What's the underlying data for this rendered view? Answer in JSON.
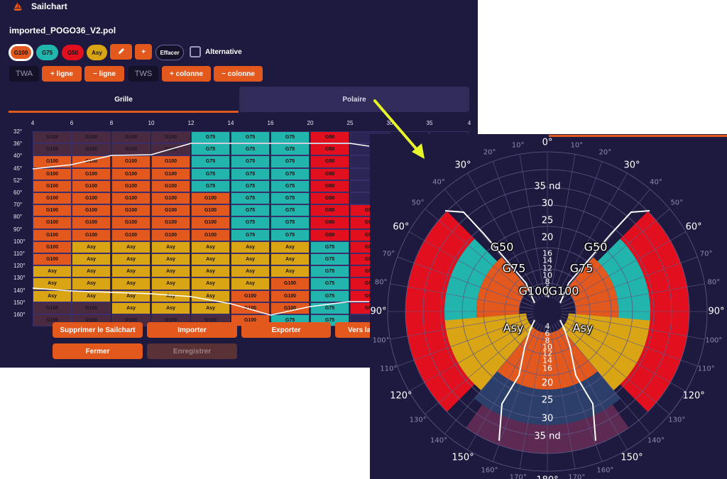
{
  "app": {
    "title": "Sailchart",
    "filename": "imported_POGO36_V2.pol"
  },
  "sails": [
    {
      "label": "G100",
      "color": "#e3581d",
      "selected": true
    },
    {
      "label": "G75",
      "color": "#21b5ad"
    },
    {
      "label": "G50",
      "color": "#e2101e"
    },
    {
      "label": "Asy",
      "color": "#d9a514"
    }
  ],
  "toolbar": {
    "edit_icon": "pencil-icon",
    "plus": "+",
    "effacer": "Effacer",
    "alternative": "Alternative",
    "twa_placeholder": "TWA",
    "add_row": "+ ligne",
    "remove_row": "− ligne",
    "tws_placeholder": "TWS",
    "add_col": "+ colonne",
    "remove_col": "− colonne"
  },
  "tabs": {
    "grille": "Grille",
    "polaire": "Polaire"
  },
  "grid": {
    "tws": [
      "4",
      "6",
      "8",
      "10",
      "12",
      "14",
      "16",
      "20",
      "25",
      "30",
      "35",
      "4"
    ],
    "twa": [
      "32°",
      "36°",
      "40°",
      "45°",
      "52°",
      "60°",
      "70°",
      "80°",
      "90°",
      "100°",
      "110°",
      "120°",
      "130°",
      "140°",
      "150°",
      "160°"
    ],
    "rows": [
      [
        "G100",
        "G100",
        "G100",
        "G100",
        "G75",
        "G75",
        "G75",
        "G50",
        "",
        "",
        ""
      ],
      [
        "G100",
        "G100",
        "G100",
        "G100",
        "G75",
        "G75",
        "G75",
        "G50",
        "",
        "",
        ""
      ],
      [
        "G100",
        "G100",
        "G100",
        "G100",
        "G75",
        "G75",
        "G75",
        "G50",
        "",
        "",
        ""
      ],
      [
        "G100",
        "G100",
        "G100",
        "G100",
        "G75",
        "G75",
        "G75",
        "G50",
        "",
        "",
        ""
      ],
      [
        "G100",
        "G100",
        "G100",
        "G100",
        "G75",
        "G75",
        "G75",
        "G50",
        "",
        "",
        ""
      ],
      [
        "G100",
        "G100",
        "G100",
        "G100",
        "G100",
        "G75",
        "G75",
        "G50",
        "",
        "",
        ""
      ],
      [
        "G100",
        "G100",
        "G100",
        "G100",
        "G100",
        "G75",
        "G75",
        "G50",
        "G50",
        "",
        ""
      ],
      [
        "G100",
        "G100",
        "G100",
        "G100",
        "G100",
        "G75",
        "G75",
        "G50",
        "G50",
        "",
        ""
      ],
      [
        "G100",
        "G100",
        "G100",
        "G100",
        "G100",
        "G75",
        "G75",
        "G50",
        "G50",
        "",
        ""
      ],
      [
        "G100",
        "Asy",
        "Asy",
        "Asy",
        "Asy",
        "Asy",
        "Asy",
        "G75",
        "G50",
        "",
        ""
      ],
      [
        "G100",
        "Asy",
        "Asy",
        "Asy",
        "Asy",
        "Asy",
        "Asy",
        "G75",
        "G50",
        "",
        ""
      ],
      [
        "Asy",
        "Asy",
        "Asy",
        "Asy",
        "Asy",
        "Asy",
        "Asy",
        "G75",
        "G50",
        "",
        ""
      ],
      [
        "Asy",
        "Asy",
        "Asy",
        "Asy",
        "Asy",
        "Asy",
        "G100",
        "G75",
        "G50",
        "",
        ""
      ],
      [
        "Asy",
        "Asy",
        "Asy",
        "Asy",
        "Asy",
        "G100",
        "G100",
        "G75",
        "G50",
        "",
        ""
      ],
      [
        "G100",
        "G100",
        "Asy",
        "Asy",
        "Asy",
        "G100",
        "G100",
        "G75",
        "G50",
        "",
        ""
      ],
      [
        "G100",
        "G100",
        "G100",
        "G100",
        "G100",
        "G100",
        "G75",
        "G75",
        "",
        "",
        ""
      ]
    ]
  },
  "actions": {
    "delete": "Supprimer le Sailchart",
    "import": "Importer",
    "export": "Exporter",
    "vers": "Vers la",
    "close": "Fermer",
    "save": "Enregistrer"
  },
  "polar": {
    "angle_labels": [
      "0°",
      "10°",
      "20°",
      "30°",
      "40°",
      "50°",
      "60°",
      "70°",
      "80°",
      "90°",
      "100°",
      "110°",
      "120°",
      "130°",
      "140°",
      "150°",
      "160°",
      "170°",
      "180°"
    ],
    "upper_speeds": [
      "35 nd",
      "30",
      "25",
      "20",
      "16",
      "14",
      "12",
      "10",
      "8",
      "6",
      "4"
    ],
    "lower_speeds": [
      "4",
      "6",
      "8",
      "10",
      "12",
      "14",
      "16",
      "20",
      "25",
      "30",
      "35 nd"
    ],
    "sail_labels": [
      "G50",
      "G75",
      "G100",
      "Asy"
    ],
    "colors": {
      "g100": "#e3581d",
      "g75": "#21b5ad",
      "g50": "#e2101e",
      "asy": "#d9a514",
      "light_air": "#5c2a52",
      "arrow": "#e8f72a"
    }
  }
}
